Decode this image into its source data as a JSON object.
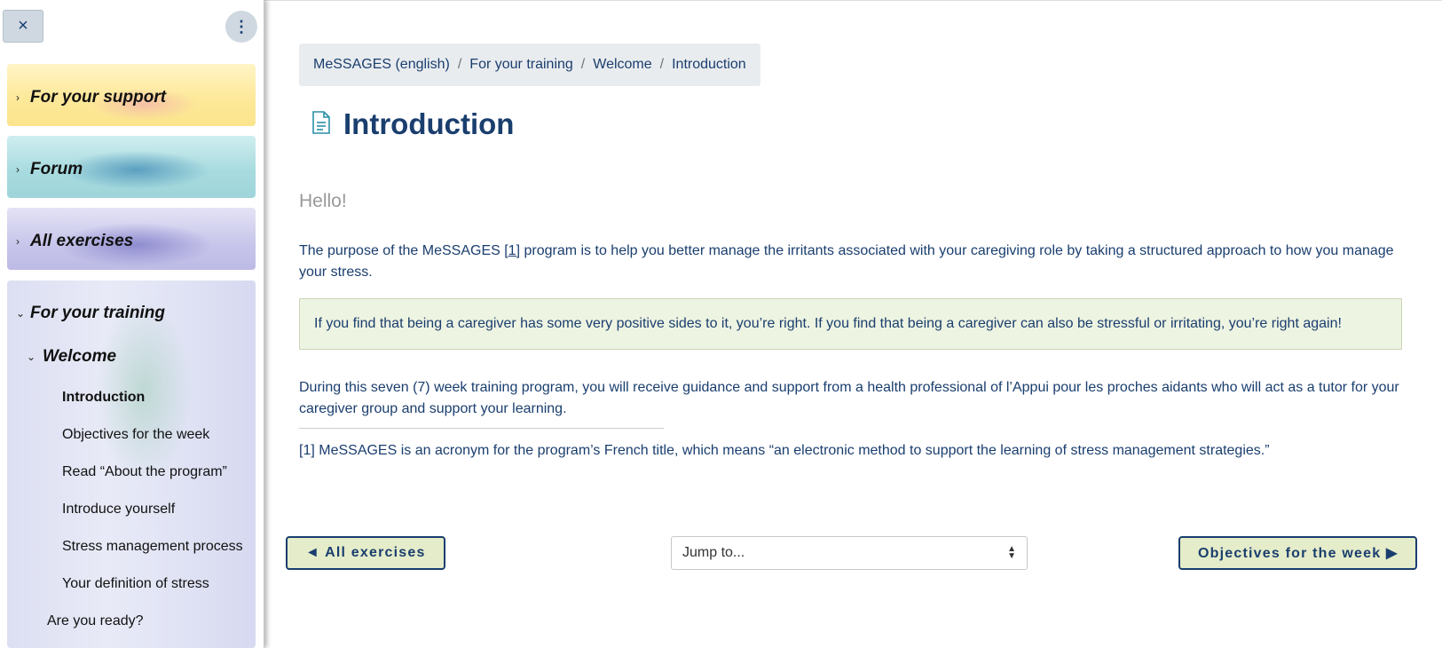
{
  "sidebar": {
    "close_icon": "×",
    "menu_icon": "⋮",
    "sections": [
      {
        "label": "For your support",
        "chevron": "›"
      },
      {
        "label": "Forum",
        "chevron": "›"
      },
      {
        "label": "All exercises",
        "chevron": "›"
      },
      {
        "label": "For your training",
        "chevron": "⌄"
      }
    ],
    "subsection": {
      "label": "Welcome",
      "chevron": "⌄"
    },
    "activities": [
      "Introduction",
      "Objectives for the week",
      "Read “About the program”",
      "Introduce yourself",
      "Stress management process",
      "Your definition of stress"
    ],
    "next_subsection": "Are you ready?"
  },
  "breadcrumb": {
    "items": [
      "MeSSAGES (english)",
      "For your training",
      "Welcome",
      "Introduction"
    ],
    "separator": "/"
  },
  "page": {
    "title": "Introduction",
    "icon": "page-document-icon",
    "greeting": "Hello!",
    "para1_before": "The purpose of the MeSSAGES ",
    "para1_ref": "[1]",
    "para1_after": " program is to help you better manage the irritants associated with your caregiving role by taking a structured approach to how you manage your stress.",
    "callout": "If you find that being a caregiver has some very positive sides to it, you’re right. If you find that being a caregiver can also be stressful or irritating, you’re right again!",
    "para2": "During this seven (7) week training program, you will receive guidance and support from a health professional of l’Appui pour les proches aidants who will act as a tutor for your caregiver group and support your learning.",
    "footnote_ref": "[1]",
    "footnote_text": " MeSSAGES is an acronym for the program’s French title, which means “an electronic method to support the learning of stress management strategies.”"
  },
  "nav": {
    "prev_label": "◄ All exercises",
    "jump_label": "Jump to...",
    "next_label": "Objectives for the week ▶"
  },
  "colors": {
    "text": "#1a3e6e",
    "callout_bg": "#eef4e2",
    "button_bg": "#e5ecc9",
    "breadcrumb_bg": "#e9ecef"
  }
}
